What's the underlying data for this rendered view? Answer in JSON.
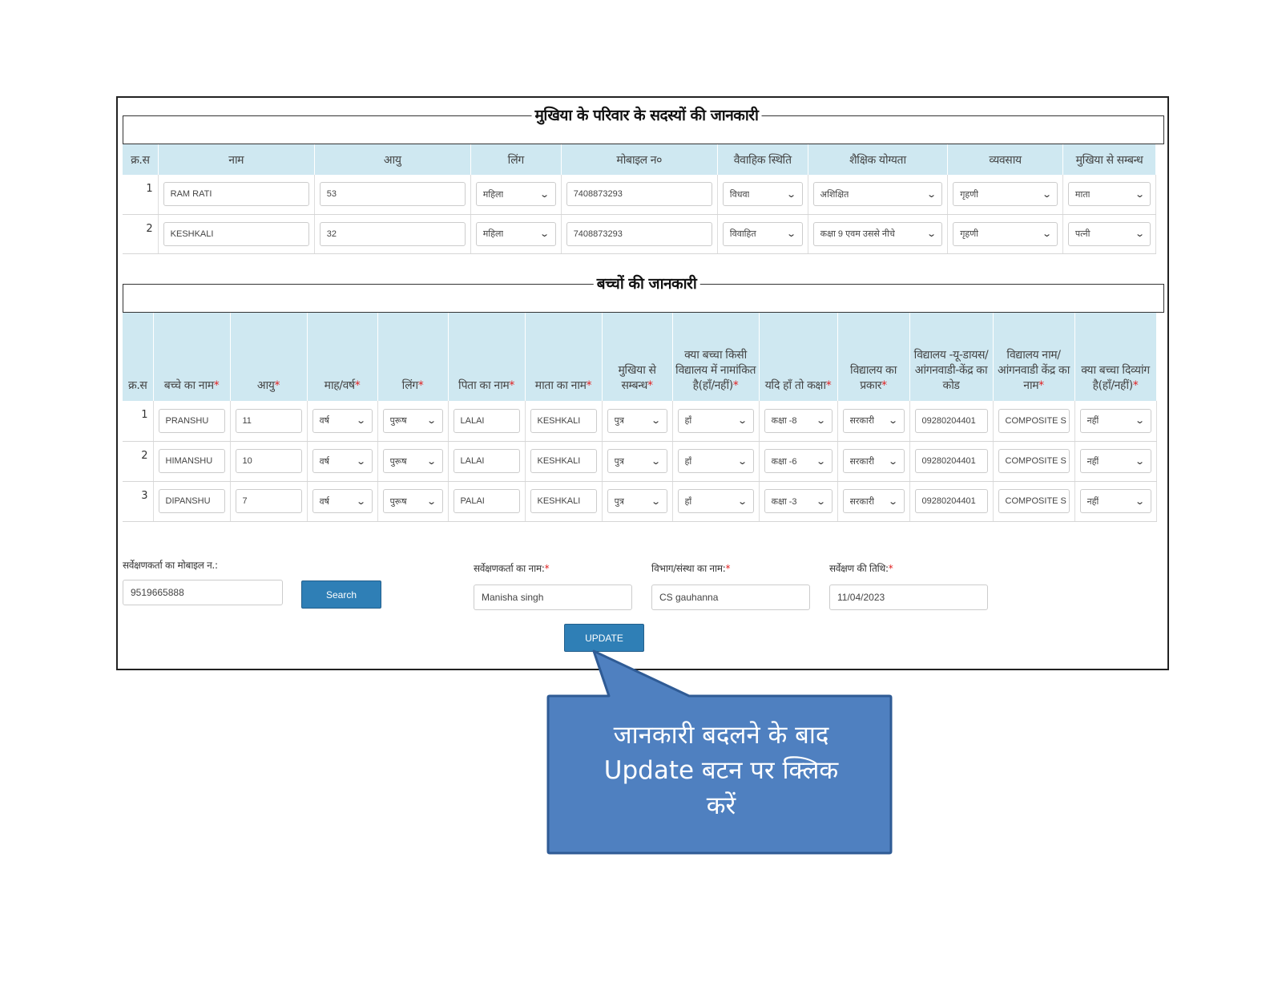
{
  "family_section": {
    "title": "मुखिया के परिवार के सदस्यों की जानकारी",
    "headers": [
      "क्र.स",
      "नाम",
      "आयु",
      "लिंग",
      "मोबाइल न०",
      "वैवाहिक स्थिति",
      "शैक्षिक योग्यता",
      "व्यवसाय",
      "मुखिया से सम्बन्ध"
    ],
    "rows": [
      {
        "sno": "1",
        "name": "RAM RATI",
        "age": "53",
        "gender": "महिला",
        "mobile": "7408873293",
        "marital": "विधवा",
        "education": "अशिक्षित",
        "occupation": "गृहणी",
        "relation": "माता"
      },
      {
        "sno": "2",
        "name": "KESHKALI",
        "age": "32",
        "gender": "महिला",
        "mobile": "7408873293",
        "marital": "विवाहित",
        "education": "कक्षा 9 एवम उससे नीचे",
        "occupation": "गृहणी",
        "relation": "पत्नी"
      }
    ]
  },
  "children_section": {
    "title": "बच्चों की जानकारी",
    "headers": [
      {
        "text": "क्र.स",
        "req": ""
      },
      {
        "text": "बच्चे का नाम",
        "req": "*"
      },
      {
        "text": "आयु",
        "req": "*"
      },
      {
        "text": "माह/वर्ष",
        "req": "*"
      },
      {
        "text": "लिंग",
        "req": "*"
      },
      {
        "text": "पिता का नाम",
        "req": "*"
      },
      {
        "text": "माता का नाम",
        "req": "*"
      },
      {
        "text": "मुखिया से सम्बन्ध",
        "req": "*"
      },
      {
        "text": "क्या बच्चा किसी विद्यालय में नामांकित है(हाँ/नहीं)",
        "req": "*"
      },
      {
        "text": "यदि हाँ तो कक्षा",
        "req": "*"
      },
      {
        "text": "विद्यालय का प्रकार",
        "req": "*"
      },
      {
        "text": "विद्यालय -यू-डायस/आंगनवाडी-केंद्र का कोड",
        "req": ""
      },
      {
        "text": "विद्यालय नाम/आंगनवाडी केंद्र का नाम",
        "req": "*"
      },
      {
        "text": "क्या बच्चा दिव्यांग है(हाँ/नहीं)",
        "req": "*"
      }
    ],
    "rows": [
      {
        "sno": "1",
        "name": "PRANSHU",
        "age": "11",
        "unit": "वर्ष",
        "gender": "पुरूष",
        "father": "LALAI",
        "mother": "KESHKALI",
        "relation": "पुत्र",
        "enrolled": "हाँ",
        "class": "कक्षा -8",
        "school_type": "सरकारी",
        "code": "09280204401",
        "school_name": "COMPOSITE S",
        "disabled": "नहीं"
      },
      {
        "sno": "2",
        "name": "HIMANSHU",
        "age": "10",
        "unit": "वर्ष",
        "gender": "पुरूष",
        "father": "LALAI",
        "mother": "KESHKALI",
        "relation": "पुत्र",
        "enrolled": "हाँ",
        "class": "कक्षा -6",
        "school_type": "सरकारी",
        "code": "09280204401",
        "school_name": "COMPOSITE S",
        "disabled": "नहीं"
      },
      {
        "sno": "3",
        "name": "DIPANSHU",
        "age": "7",
        "unit": "वर्ष",
        "gender": "पुरूष",
        "father": "PALAI",
        "mother": "KESHKALI",
        "relation": "पुत्र",
        "enrolled": "हाँ",
        "class": "कक्षा -3",
        "school_type": "सरकारी",
        "code": "09280204401",
        "school_name": "COMPOSITE S",
        "disabled": "नहीं"
      }
    ]
  },
  "survey": {
    "mobile_label": "सर्वेक्षणकर्ता का मोबाइल न.:",
    "mobile_value": "9519665888",
    "search_label": "Search",
    "name_label": "सर्वेक्षणकर्ता का नाम:",
    "name_value": "Manisha singh",
    "dept_label": "विभाग/संस्था का नाम:",
    "dept_value": "CS gauhanna",
    "date_label": "सर्वेक्षण की तिथि:",
    "date_value": "11/04/2023",
    "required_mark": "*",
    "update_label": "UPDATE"
  },
  "callout": {
    "line1": "जानकारी बदलने के बाद",
    "line2": "Update बटन पर क्लिक",
    "line3": "करें",
    "color": "#4f80c0",
    "border_color": "#2f5b95"
  },
  "colors": {
    "header_bg": "#cfe8f1",
    "button": "#2f7fb6",
    "required": "#e02020"
  }
}
